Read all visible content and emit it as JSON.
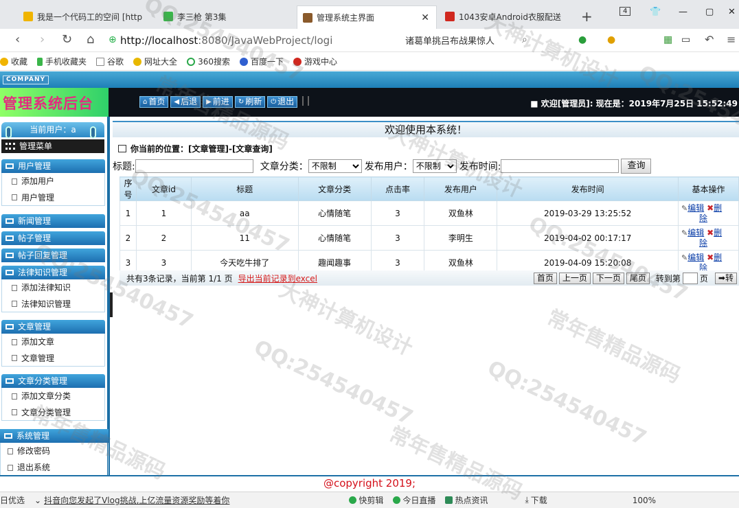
{
  "browser": {
    "tabs": [
      {
        "title": "我是一个代码工的空间 [http",
        "icon_color": "#f0b400"
      },
      {
        "title": "李三枪 第3集",
        "icon_color": "#3ab54a"
      },
      {
        "title": "管理系统主界面",
        "icon_color": "#8a5a2b"
      },
      {
        "title": "1043安卓Android衣服配送",
        "icon_color": "#d0281f"
      }
    ],
    "tab_count": "4",
    "url_host": "http://localhost",
    "url_rest": ":8080/JavaWebProject/logi",
    "search_text": "诸葛单挑吕布战果惊人",
    "bookmarks": [
      "收藏",
      "手机收藏夹",
      "谷歌",
      "网址大全",
      "360搜索",
      "百度一下",
      "游戏中心"
    ]
  },
  "page": {
    "company_badge": "COMPANY",
    "logo_text": "管理系统后台",
    "header_buttons": [
      "首页",
      "后退",
      "前进",
      "刷新",
      "退出"
    ],
    "welcome_text": "■ 欢迎[管理员]:  现在是：2019年7月25日 15:52:49",
    "sidebar": {
      "current_user": "当前用户：a",
      "menu_title": "管理菜单",
      "groups": [
        {
          "title": "用户管理",
          "items": [
            "添加用户",
            "用户管理"
          ]
        },
        {
          "title": "新闻管理",
          "items": []
        },
        {
          "title": "帖子管理",
          "items": []
        },
        {
          "title": "帖子回复管理",
          "items": []
        },
        {
          "title": "法律知识管理",
          "items": [
            "添加法律知识",
            "法律知识管理"
          ]
        },
        {
          "title": "文章管理",
          "items": [
            "添加文章",
            "文章管理"
          ]
        },
        {
          "title": "文章分类管理",
          "items": [
            "添加文章分类",
            "文章分类管理"
          ]
        },
        {
          "title": "系统管理",
          "items": [
            "修改密码",
            "退出系统"
          ]
        }
      ]
    },
    "welcome_banner": "欢迎使用本系统！",
    "breadcrumb": "你当前的位置：[文章管理]-[文章查询]",
    "filters": {
      "title_label": "标题:",
      "title_value": "",
      "category_label": "文章分类：",
      "category_value": "不限制",
      "publisher_label": "发布用户：",
      "publisher_value": "不限制",
      "time_label": "发布时间:",
      "time_value": "",
      "query_button": "查询"
    },
    "table": {
      "headers": [
        "序号",
        "文章id",
        "标题",
        "文章分类",
        "点击率",
        "发布用户",
        "发布时间",
        "基本操作"
      ],
      "rows": [
        [
          "1",
          "1",
          "aa",
          "心情随笔",
          "3",
          "双鱼林",
          "2019-03-29 13:25:52"
        ],
        [
          "2",
          "2",
          "11",
          "心情随笔",
          "3",
          "李明生",
          "2019-04-02 00:17:17"
        ],
        [
          "3",
          "3",
          "今天吃牛排了",
          "趣闻趣事",
          "3",
          "双鱼林",
          "2019-04-09 15:20:08"
        ]
      ],
      "edit_label_1": "编辑",
      "edit_label_2": "辑",
      "del_label_1": "删",
      "del_label_2": "除"
    },
    "pager": {
      "summary": "共有3条记录，当前第 1/1 页",
      "export_link": "导出当前记录到excel",
      "buttons": [
        "首页",
        "上一页",
        "下一页",
        "尾页"
      ],
      "goto_label": "转到第",
      "page_unit": "页",
      "go_button": "转"
    },
    "footer": "@copyright 2019;"
  },
  "statusbar": {
    "left": "日优选",
    "news": "抖音向您发起了Vlog挑战,上亿流量资源奖励等着你",
    "items": [
      "快剪辑",
      "今日直播",
      "热点资讯",
      "下载"
    ],
    "zoom": "100%"
  },
  "watermarks": [
    "QQ:254540457",
    "大神计算机设计",
    "常年售精品源码"
  ]
}
